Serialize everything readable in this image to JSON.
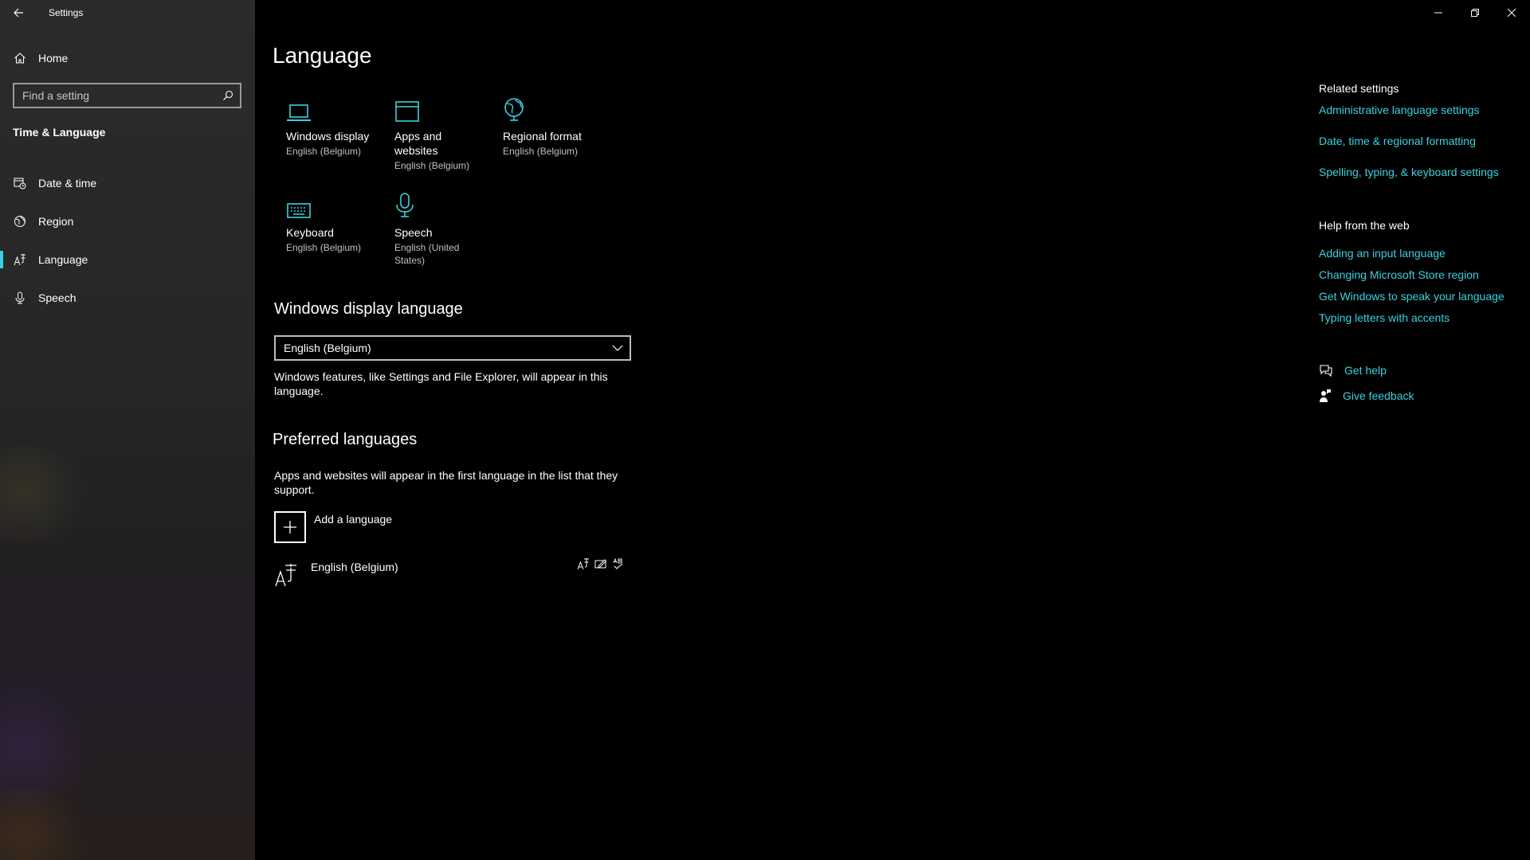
{
  "app": {
    "title": "Settings"
  },
  "sidebar": {
    "home_label": "Home",
    "search_placeholder": "Find a setting",
    "section_title": "Time & Language",
    "items": [
      {
        "label": "Date & time",
        "icon": "calendar-clock-icon"
      },
      {
        "label": "Region",
        "icon": "globe-icon"
      },
      {
        "label": "Language",
        "icon": "language-icon",
        "active": true
      },
      {
        "label": "Speech",
        "icon": "microphone-icon"
      }
    ]
  },
  "main": {
    "title": "Language",
    "tiles": [
      {
        "name": "Windows display",
        "sub": "English (Belgium)",
        "icon": "laptop-icon"
      },
      {
        "name": "Apps and websites",
        "sub": "English (Belgium)",
        "icon": "browser-window-icon"
      },
      {
        "name": "Regional format",
        "sub": "English (Belgium)",
        "icon": "regional-globe-icon"
      },
      {
        "name": "Keyboard",
        "sub": "English (Belgium)",
        "icon": "keyboard-icon"
      },
      {
        "name": "Speech",
        "sub": "English (United States)",
        "icon": "microphone-icon"
      }
    ],
    "display_language": {
      "heading": "Windows display language",
      "selected": "English (Belgium)",
      "description": "Windows features, like Settings and File Explorer, will appear in this language."
    },
    "preferred": {
      "heading": "Preferred languages",
      "description": "Apps and websites will appear in the first language in the list that they support.",
      "add_label": "Add a language",
      "languages": [
        {
          "name": "English (Belgium)",
          "capabilities": [
            "display-language-icon",
            "handwriting-icon",
            "spellcheck-icon"
          ]
        }
      ]
    }
  },
  "right": {
    "related_title": "Related settings",
    "related_links": [
      "Administrative language settings",
      "Date, time & regional formatting",
      "Spelling, typing, & keyboard settings"
    ],
    "help_title": "Help from the web",
    "help_links": [
      "Adding an input language",
      "Changing Microsoft Store region",
      "Get Windows to speak your language",
      "Typing letters with accents"
    ],
    "get_help": "Get help",
    "give_feedback": "Give feedback"
  },
  "colors": {
    "accent": "#3ad1e0",
    "background": "#000000",
    "sidebar": "#2b2b2b"
  }
}
